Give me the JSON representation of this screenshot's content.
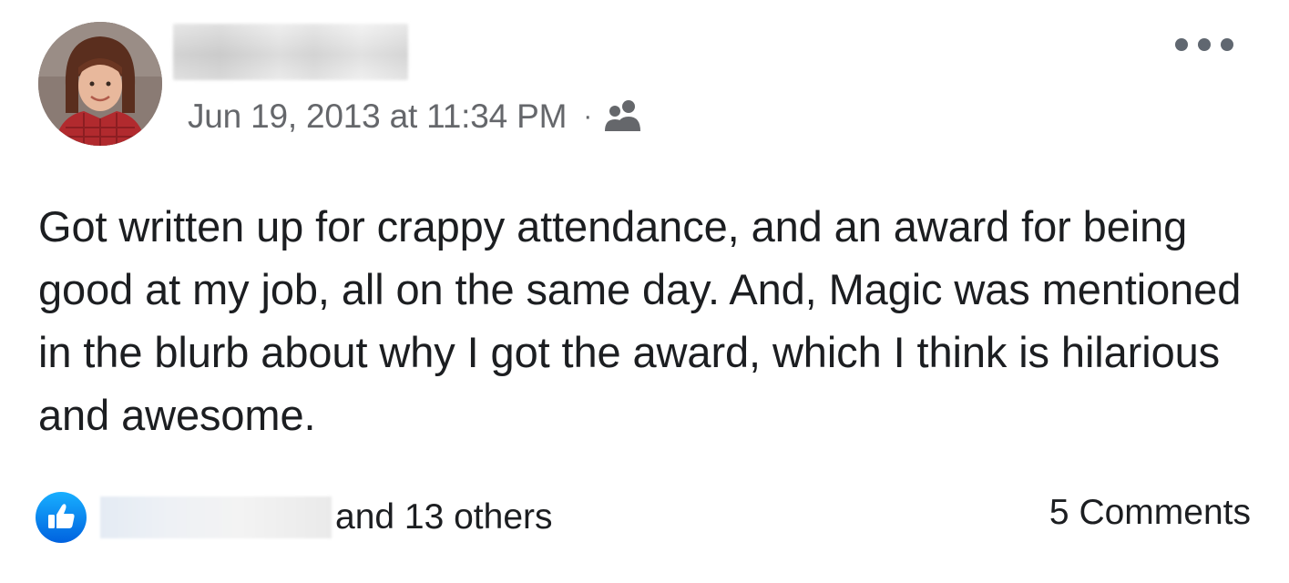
{
  "post": {
    "timestamp": "Jun 19, 2013 at 11:34 PM",
    "separator": "·",
    "audience_icon": "friends-icon",
    "more_icon": "more-options-icon",
    "text": "Got written up for crappy attendance, and an award for being good at my job, all on the same day. And, Magic was mentioned in the blurb about why I got the award, which I think is hilarious and awesome."
  },
  "footer": {
    "reaction_icon": "like-icon",
    "others_text": "and 13 others",
    "comments_text": "5 Comments"
  },
  "colors": {
    "meta_text": "#65676b",
    "like_blue": "#1877f2",
    "body_text": "#1c1e21"
  }
}
